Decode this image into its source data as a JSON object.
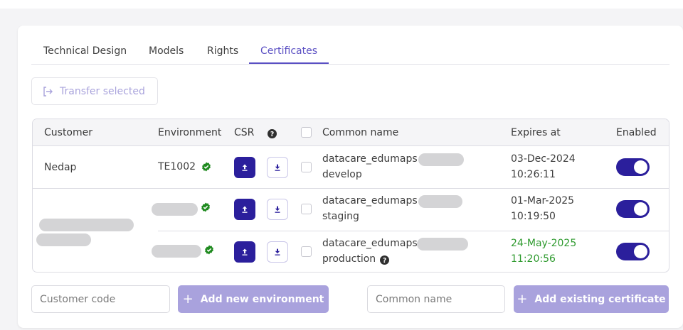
{
  "tabs": [
    {
      "label": "Technical Design"
    },
    {
      "label": "Models"
    },
    {
      "label": "Rights"
    },
    {
      "label": "Certificates"
    }
  ],
  "toolbar": {
    "transfer_label": "Transfer selected",
    "transfer_icon": "log-out-icon"
  },
  "table": {
    "headers": {
      "customer": "Customer",
      "environment": "Environment",
      "csr": "CSR",
      "help_icon": "question-circle-icon",
      "common_name": "Common name",
      "expires_at": "Expires at",
      "enabled": "Enabled"
    },
    "rows": [
      {
        "customer": "Nedap",
        "environment": "TE1002",
        "verified": true,
        "common_name_prefix": "datacare_edumaps",
        "common_name_suffix": "develop",
        "expires_date": "03-Dec-2024",
        "expires_time": "10:26:11",
        "enabled": true,
        "highlight": false
      },
      {
        "customer": "",
        "environment": "",
        "verified": true,
        "common_name_prefix": "datacare_edumaps",
        "common_name_suffix": "staging",
        "expires_date": "01-Mar-2025",
        "expires_time": "10:19:50",
        "enabled": true,
        "highlight": false
      },
      {
        "customer": "",
        "environment": "",
        "verified": true,
        "common_name_prefix": "datacare_edumaps",
        "common_name_suffix": "production",
        "expires_date": "24-May-2025",
        "expires_time": "11:20:56",
        "enabled": true,
        "highlight": true
      }
    ]
  },
  "form": {
    "customer_code_placeholder": "Customer code",
    "add_environment_label": "Add new environment",
    "common_name_placeholder": "Common name",
    "add_certificate_label": "Add existing certificate",
    "plus_icon": "plus-icon"
  },
  "colors": {
    "accent": "#2b1f9c",
    "tab_active": "#5a4fc3",
    "disabled_button": "#a9a2dd",
    "success": "#2e9a2e"
  }
}
